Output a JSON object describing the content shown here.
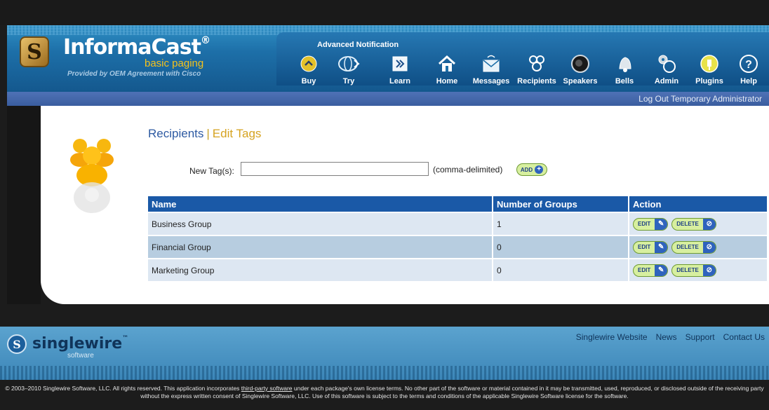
{
  "header": {
    "brand": "InformaCast",
    "brand_mark": "®",
    "edition": "basic paging",
    "provided_by": "Provided by OEM Agreement with Cisco",
    "advanced_label": "Advanced Notification",
    "nav": [
      {
        "label": "Buy",
        "icon": "buy-icon"
      },
      {
        "label": "Try",
        "icon": "try-icon"
      },
      {
        "label": "Learn",
        "icon": "learn-icon"
      },
      {
        "label": "Home",
        "icon": "home-icon"
      },
      {
        "label": "Messages",
        "icon": "messages-icon"
      },
      {
        "label": "Recipients",
        "icon": "recipients-icon"
      },
      {
        "label": "Speakers",
        "icon": "speakers-icon"
      },
      {
        "label": "Bells",
        "icon": "bells-icon"
      },
      {
        "label": "Admin",
        "icon": "admin-icon"
      },
      {
        "label": "Plugins",
        "icon": "plugins-icon"
      },
      {
        "label": "Help",
        "icon": "help-icon"
      }
    ],
    "logout": "Log Out Temporary Administrator"
  },
  "main": {
    "title": "Recipients",
    "title_sep": "|",
    "subtitle": "Edit Tags",
    "new_tag_label": "New Tag(s):",
    "new_tag_value": "",
    "comma_hint": "(comma-delimited)",
    "add_label": "ADD",
    "table": {
      "columns": [
        "Name",
        "Number of Groups",
        "Action"
      ],
      "rows": [
        {
          "name": "Business Group",
          "groups": "1"
        },
        {
          "name": "Financial Group",
          "groups": "0"
        },
        {
          "name": "Marketing Group",
          "groups": "0"
        }
      ],
      "edit_label": "EDIT",
      "delete_label": "DELETE"
    }
  },
  "footer": {
    "logo_name": "singlewire",
    "logo_mark": "™",
    "logo_sub": "software",
    "links": [
      "Singlewire Website",
      "News",
      "Support",
      "Contact Us"
    ],
    "copyright_pre": "© 2003–2010 Singlewire Software, LLC. All rights reserved. This application incorporates ",
    "copyright_link": "third-party software",
    "copyright_mid": " under each package's own license terms. No other part of the software or material contained in it may be transmitted, used, reproduced, or disclosed outside of the receiving party without the express written consent of Singlewire Software, LLC. Use of this software is subject to the terms and conditions of the applicable Singlewire Software license for the software."
  },
  "colors": {
    "header_blue": "#1d6fa8",
    "table_header": "#1a59a7",
    "title_blue": "#2d5aa2",
    "title_gold": "#d6a320"
  }
}
